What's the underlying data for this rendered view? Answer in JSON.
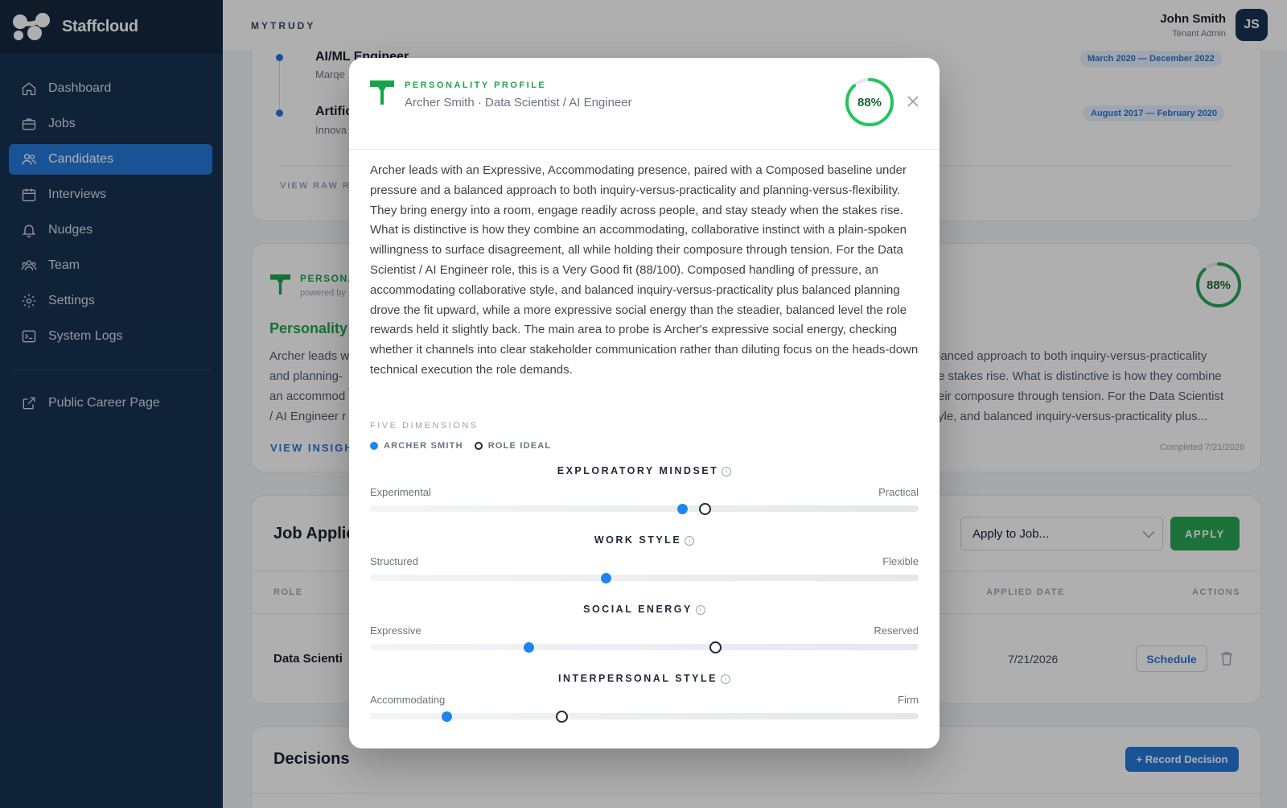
{
  "brand": {
    "name": "Staffcloud"
  },
  "sidebar": {
    "items": [
      {
        "label": "Dashboard",
        "icon": "home-icon"
      },
      {
        "label": "Jobs",
        "icon": "briefcase-icon"
      },
      {
        "label": "Candidates",
        "icon": "users-icon",
        "active": true
      },
      {
        "label": "Interviews",
        "icon": "calendar-icon"
      },
      {
        "label": "Nudges",
        "icon": "bell-icon"
      },
      {
        "label": "Team",
        "icon": "team-icon"
      },
      {
        "label": "Settings",
        "icon": "gear-icon"
      },
      {
        "label": "System Logs",
        "icon": "terminal-icon"
      }
    ],
    "footer_item": {
      "label": "Public Career Page",
      "icon": "external-link-icon"
    }
  },
  "topbar": {
    "title": "MYTRUDY",
    "user_name": "John Smith",
    "user_role": "Tenant Admin",
    "user_initials": "JS"
  },
  "experience": [
    {
      "title": "AI/ML Engineer",
      "company": "Marqe",
      "dates": "March 2020 — December 2022"
    },
    {
      "title": "Artific",
      "company": "Innova",
      "dates": "August 2017 — February 2020"
    }
  ],
  "experience_link": "VIEW RAW RE",
  "personality_card": {
    "label": "PERSONA",
    "powered": "powered by",
    "heading": "Personality",
    "left_lines": [
      "Archer leads w",
      "and planning-",
      "an accommod",
      "/ AI Engineer r"
    ],
    "right_lines": [
      "lanced approach to both inquiry-versus-practicality",
      "e stakes rise. What is distinctive is how they combine",
      "eir composure through tension. For the Data Scientist",
      "yle, and balanced inquiry-versus-practicality plus..."
    ],
    "link": "VIEW INSIGHT",
    "completed": "Completed 7/21/2026",
    "score": "88%",
    "score_value": 0.88
  },
  "job_applications": {
    "title": "Job Applic",
    "select_placeholder": "Apply to Job...",
    "apply_label": "APPLY",
    "headers": {
      "role": "ROLE",
      "applied_date": "APPLIED DATE",
      "actions": "ACTIONS"
    },
    "rows": [
      {
        "role": "Data Scienti",
        "date": "7/21/2026",
        "action": "Schedule"
      }
    ]
  },
  "decisions": {
    "title": "Decisions",
    "button": "+ Record Decision"
  },
  "modal": {
    "label": "PERSONALITY PROFILE",
    "subtitle": "Archer Smith · Data Scientist / AI Engineer",
    "score": "88%",
    "score_value": 0.88,
    "summary": "Archer leads with an Expressive, Accommodating presence, paired with a Composed baseline under pressure and a balanced approach to both inquiry-versus-practicality and planning-versus-flexibility. They bring energy into a room, engage readily across people, and stay steady when the stakes rise. What is distinctive is how they combine an accommodating, collaborative instinct with a plain-spoken willingness to surface disagreement, all while holding their composure through tension. For the Data Scientist / AI Engineer role, this is a Very Good fit (88/100). Composed handling of pressure, an accommodating collaborative style, and balanced inquiry-versus-practicality plus balanced planning drove the fit upward, while a more expressive social energy than the steadier, balanced level the role rewards held it slightly back. The main area to probe is Archer's expressive social energy, checking whether it channels into clear stakeholder communication rather than diluting focus on the heads-down technical execution the role demands.",
    "dims_label": "FIVE DIMENSIONS",
    "legend": {
      "candidate": "ARCHER SMITH",
      "ideal": "ROLE IDEAL"
    },
    "dimensions": [
      {
        "title": "EXPLORATORY MINDSET",
        "left": "Experimental",
        "right": "Practical",
        "candidate": 0.57,
        "ideal": 0.61
      },
      {
        "title": "WORK STYLE",
        "left": "Structured",
        "right": "Flexible",
        "candidate": 0.43,
        "ideal": null
      },
      {
        "title": "SOCIAL ENERGY",
        "left": "Expressive",
        "right": "Reserved",
        "candidate": 0.29,
        "ideal": 0.63
      },
      {
        "title": "INTERPERSONAL STYLE",
        "left": "Accommodating",
        "right": "Firm",
        "candidate": 0.14,
        "ideal": 0.35
      }
    ]
  },
  "colors": {
    "sidebar": "#0f2a4a",
    "accent": "#1e72d9",
    "green": "#22a34f"
  }
}
